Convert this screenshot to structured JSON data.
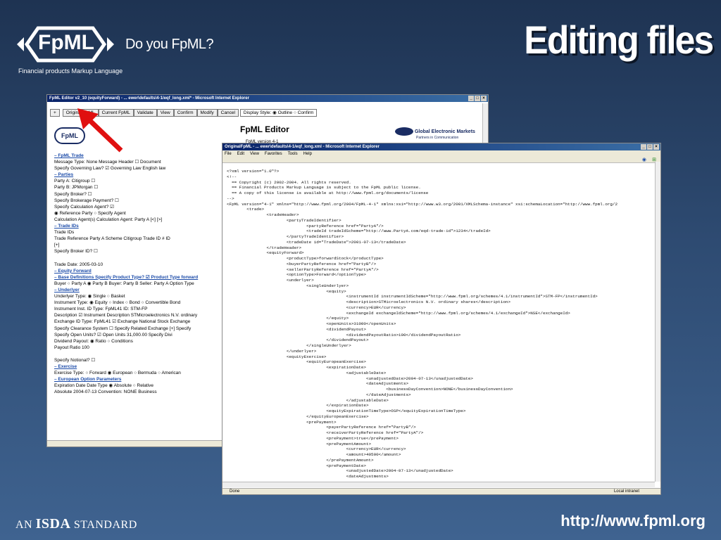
{
  "slide": {
    "logo_text": "FpML",
    "logo_subtitle": "Financial products Markup Language",
    "tagline": "Do you FpML?",
    "title": "Editing files",
    "isda_prefix": "AN",
    "isda_word": "ISDA",
    "isda_suffix": "STANDARD",
    "url": "http://www.fpml.org"
  },
  "editor": {
    "title": "FpML Editor v2_10 (equityForward) - ... ewer\\defaults\\4-1/eqf_long.xml* - Microsoft Internet Explorer",
    "toolbar": [
      "+",
      "Original FpML",
      "Current FpML",
      "Validate",
      "View",
      "Confirm",
      "Modify",
      "Cancel"
    ],
    "display_style_label": "Display Style:",
    "display_options": [
      "Outline",
      "Confirm"
    ],
    "heading": "FpML Editor",
    "version": "FpML version 4-1",
    "partner_logo": "Global Electronic Markets",
    "partner_sub": "Partners in Communication",
    "small_logo": "FpML",
    "lines": [
      "– FpML Trade",
      "Message Type: None          Message Header ☐ Document",
      "Specify Governing Law? ☑ Governing Law English law",
      "– Parties",
      "Party A: Citigroup  ☐",
      "Party B: JPMorgan  ☐",
      "Specify Broker? ☐",
      "Specify Brokerage Payment? ☐",
      "Specify Calculation Agent? ☑",
      "◉ Reference Party ○ Specify Agent",
      "Calculation Agent(s) Calculation Agent: Party A [<] [>]",
      "– Trade IDs",
      "Trade IDs",
      "Trade Reference  Party A  Scheme Citigroup Trade ID #  ID",
      "[+]",
      "Specify Broker ID? ☐",
      "",
      "Trade Date: 2005-03-10",
      "– Equity Forward",
      "– Base Definitions  Specify Product Type? ☑ Product Type forward",
      "Buyer ○ Party A ◉ Party B  Buyer: Party B Seller: Party A Option Type",
      "– Underlyer",
      "Underlyer Type: ◉ Single ○ Basket",
      "Instrument Type: ◉ Equity ○ Index ○ Bond ○ Convertible Bond",
      "Instrument Inst. ID Type: FpML41  ID: STM-FP",
      "Description ☑ Instrument Description STMicroelectronics N.V. ordinary",
      "Exchange ID Type: FpML41 ☑ Exchange National Stock Exchange",
      "Specify Clearance System ☐ Specify Related Exchange [+] Specify",
      "Specify Open Units? ☑ Open Units 31,000.00  Specify Divi",
      "Dividend Payout: ◉ Ratio ○ Conditions",
      "Payout Ratio 100",
      "",
      "Specify Notional? ☐",
      "– Exercise",
      "Exercise Type: ○ Forward ◉ European ○ Bermuda ○ American",
      "– European Option Parameters",
      "Expiration Date Date Type ◉ Absolute ○ Relative",
      "Absolute 2004-07-13  Convention: NONE  Business"
    ]
  },
  "original": {
    "title": "OriginalFpML - ... ewer\\defaults\\4-1/eqf_long.xml - Microsoft Internet Explorer",
    "menu": [
      "File",
      "Edit",
      "View",
      "Favorites",
      "Tools",
      "Help"
    ],
    "status_left": "Done",
    "status_right": "Local intranet",
    "xml": [
      "<?xml version=\"1.0\"?>",
      "<!--",
      "  == Copyright (c) 2002-2004. All rights reserved.",
      "  == Financial Products Markup Language is subject to the FpML public license.",
      "  == A copy of this license is available at http://www.fpml.org/documents/license",
      "-->",
      "<FpML version=\"4-1\" xmlns=\"http://www.fpml.org/2004/FpML-4-1\" xmlns:xsi=\"http://www.w3.org/2001/XMLSchema-instance\" xsi:schemaLocation=\"http://www.fpml.org/2",
      "        <trade>",
      "                <tradeHeader>",
      "                        <partyTradeIdentifier>",
      "                                <partyReference href=\"PartyA\"/>",
      "                                <tradeId tradeIdScheme=\"http://www.PartyA.com/eqd-trade-id\">1234</tradeId>",
      "                        </partyTradeIdentifier>",
      "                        <tradeDate id=\"TradeDate\">2001-07-13</tradeDate>",
      "                </tradeHeader>",
      "                <equityForward>",
      "                        <productType>forwardStock</productType>",
      "                        <buyerPartyReference href=\"PartyB\"/>",
      "                        <sellerPartyReference href=\"PartyA\"/>",
      "                        <optionType>Forward</optionType>",
      "                        <underlyer>",
      "                                <singleUnderlyer>",
      "                                        <equity>",
      "                                                <instrumentId instrumentIdScheme=\"http://www.fpml.org/schemes/4.1/instrumentId\">STM-FP</instrumentId>",
      "                                                <description>STMicroelectronics N.V. ordinary shares</description>",
      "                                                <currency>EUR</currency>",
      "                                                <exchangeId exchangeIdScheme=\"http://www.fpml.org/schemes/4.1/exchangeId\">NSE</exchangeId>",
      "                                        </equity>",
      "                                        <openUnits>31000</openUnits>",
      "                                        <dividendPayout>",
      "                                                <dividendPayoutRatio>100</dividendPayoutRatio>",
      "                                        </dividendPayout>",
      "                                </singleUnderlyer>",
      "                        </underlyer>",
      "                        <equityExercise>",
      "                                <equityEuropeanExercise>",
      "                                        <expirationDate>",
      "                                                <adjustableDate>",
      "                                                        <unadjustedDate>2004-07-13</unadjustedDate>",
      "                                                        <dateAdjustments>",
      "                                                                <businessDayConvention>NONE</businessDayConvention>",
      "                                                        </dateAdjustments>",
      "                                                </adjustableDate>",
      "                                        </expirationDate>",
      "                                        <equityExpirationTimeType>OSP</equityExpirationTimeType>",
      "                                </equityEuropeanExercise>",
      "                                <prePayment>",
      "                                        <payerPartyReference href=\"PartyB\"/>",
      "                                        <receiverPartyReference href=\"PartyA\"/>",
      "                                        <prePayment>true</prePayment>",
      "                                        <prePaymentAmount>",
      "                                                <currency>EUR</currency>",
      "                                                <amount>40500</amount>",
      "                                        </prePaymentAmount>",
      "                                        <prePaymentDate>",
      "                                                <unadjustedDate>2004-07-13</unadjustedDate>",
      "                                                <dateAdjustments>"
    ]
  }
}
